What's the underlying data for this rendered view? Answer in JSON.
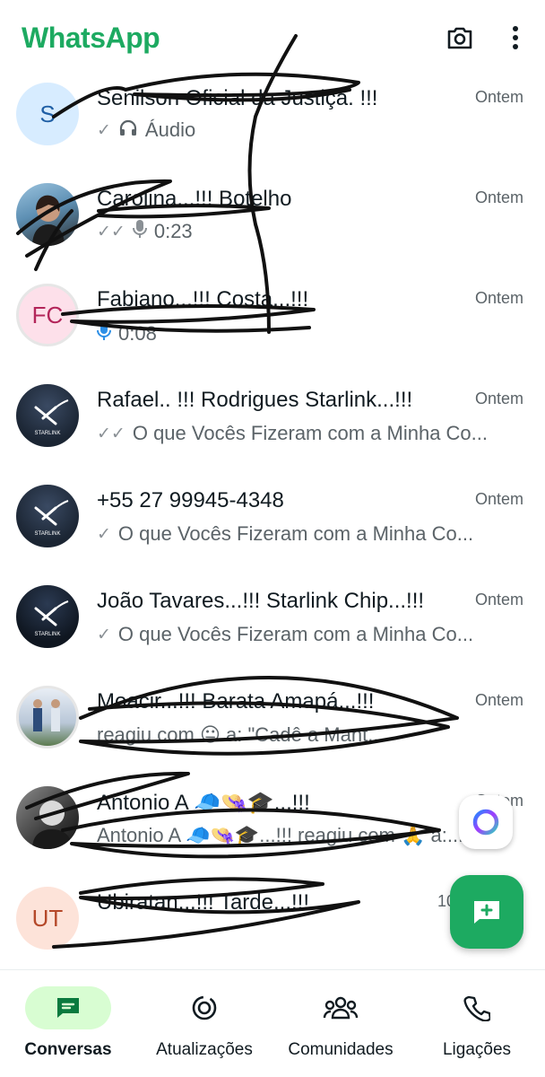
{
  "header": {
    "title": "WhatsApp",
    "camera_icon": "camera-icon",
    "menu_icon": "more-vert-icon",
    "brand_color": "#1daa61"
  },
  "chats": [
    {
      "name": "Senilson Oficial da Justiça. !!!",
      "time": "Ontem",
      "preview": "Áudio",
      "status": "sent",
      "media_icon": "headphones-icon",
      "avatar_initials": "S",
      "avatar_bg": "#d7ecff",
      "avatar_fg": "#1f5fa5"
    },
    {
      "name": "Carolina...!!! Botelho",
      "time": "Ontem",
      "preview": "0:23",
      "status": "delivered",
      "media_icon": "mic-icon",
      "avatar_initials": "",
      "avatar_bg": "#6aa3c8"
    },
    {
      "name": "Fabiano...!!! Costa...!!!",
      "time": "Ontem",
      "preview": "0:08",
      "status": "",
      "media_icon": "mic-icon-blue",
      "avatar_initials": "FC",
      "avatar_bg": "#fde0ea",
      "avatar_fg": "#b3265a"
    },
    {
      "name": "Rafael.. !!! Rodrigues Starlink...!!!",
      "time": "Ontem",
      "preview": "O que Vocês Fizeram com a Minha  Co...",
      "status": "delivered",
      "media_icon": "",
      "avatar_initials": "",
      "avatar_bg": "#1b2533"
    },
    {
      "name": "+55 27 99945-4348",
      "time": "Ontem",
      "preview": "O que Vocês Fizeram com a Minha  Co...",
      "status": "sent",
      "media_icon": "",
      "avatar_initials": "",
      "avatar_bg": "#1b2533"
    },
    {
      "name": "João Tavares...!!! Starlink Chip...!!!",
      "time": "Ontem",
      "preview": "O que Vocês Fizeram com a Minha  Co...",
      "status": "sent",
      "media_icon": "",
      "avatar_initials": "",
      "avatar_bg": "#0f1620"
    },
    {
      "name": "Moacir...!!! Barata Amapá...!!!",
      "time": "Ontem",
      "preview": "reagiu com 😐 a: \"Cadê a Mant...",
      "status": "",
      "media_icon": "",
      "avatar_initials": "",
      "avatar_bg": "#c9d4e0"
    },
    {
      "name": "Antonio A 🧢👒🎓...!!!",
      "time": "Ontem",
      "preview": "Antonio A 🧢👒🎓...!!! reagiu com 🙏 a:...",
      "status": "",
      "media_icon": "",
      "avatar_initials": "",
      "avatar_bg": "#3a3a3a"
    },
    {
      "name": "Ubiratan...!!! Tarde...!!!",
      "time": "10",
      "preview": "",
      "status": "",
      "media_icon": "",
      "avatar_initials": "UT",
      "avatar_bg": "#fde3d9",
      "avatar_fg": "#b5492a"
    }
  ],
  "starlink_logo_text": "STARLINK",
  "fab": {
    "meta_ai_icon": "meta-ai-icon",
    "new_chat_icon": "new-chat-icon"
  },
  "nav": {
    "items": [
      {
        "label": "Conversas",
        "icon": "chats-icon",
        "active": true
      },
      {
        "label": "Atualizações",
        "icon": "updates-icon",
        "active": false
      },
      {
        "label": "Comunidades",
        "icon": "communities-icon",
        "active": false
      },
      {
        "label": "Ligações",
        "icon": "calls-icon",
        "active": false
      }
    ]
  }
}
